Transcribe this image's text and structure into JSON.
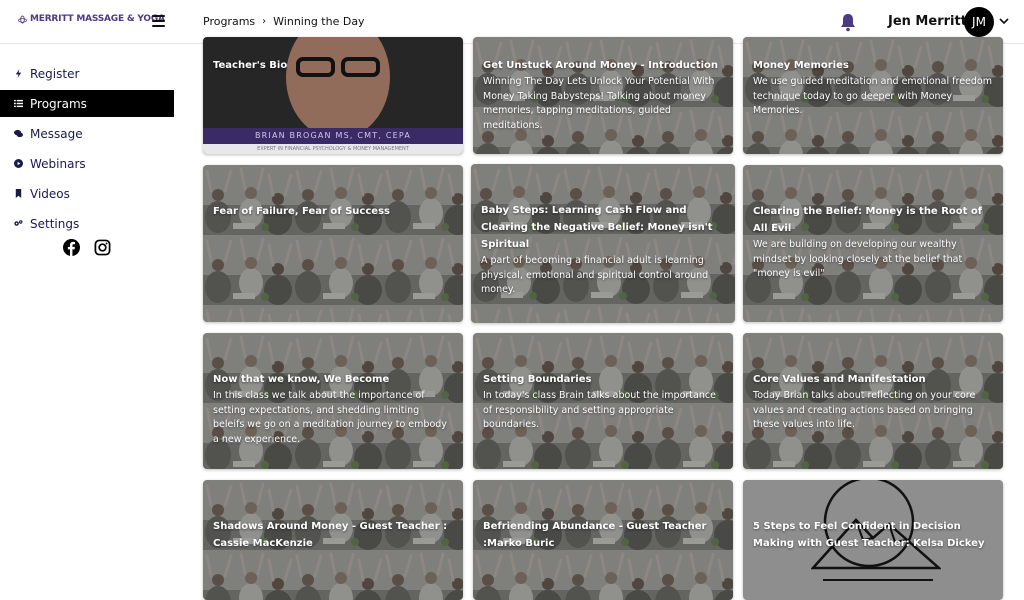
{
  "app": {
    "logo_text": "MERRITT MASSAGE & YOGA",
    "brand_color": "#4b3b86"
  },
  "breadcrumb": {
    "items": [
      "Programs",
      "Winning the Day"
    ]
  },
  "user": {
    "name": "Jen Merritt",
    "initials": "JM"
  },
  "sidebar": {
    "items": [
      {
        "label": "Register",
        "icon": "bolt-icon",
        "active": false
      },
      {
        "label": "Programs",
        "icon": "list-icon",
        "active": true
      },
      {
        "label": "Message",
        "icon": "chat-icon",
        "active": false
      },
      {
        "label": "Webinars",
        "icon": "play-circle-icon",
        "active": false
      },
      {
        "label": "Videos",
        "icon": "bookmark-icon",
        "active": false
      },
      {
        "label": "Settings",
        "icon": "gears-icon",
        "active": false
      }
    ],
    "social": [
      "facebook-icon",
      "instagram-icon"
    ]
  },
  "cards": [
    {
      "title": "Teacher's Bio",
      "desc": "",
      "image": "portrait",
      "band": "BRIAN BROGAN MS, CMT, CEPA",
      "band_sub": "EXPERT IN FINANCIAL PSYCHOLOGY & MONEY MANAGEMENT"
    },
    {
      "title": "Get Unstuck Around Money - Introduction",
      "desc": "Winning The Day Lets Unlock Your Potential With Money Taking Babysteps! Talking about money memories, tapping meditations, guided meditations.",
      "image": "crowd"
    },
    {
      "title": "Money Memories",
      "desc": "We use guided meditation and emotional freedom technique today to go deeper with Money Memories.",
      "image": "crowd"
    },
    {
      "title": "Fear of Failure, Fear of Success",
      "desc": "",
      "image": "crowd"
    },
    {
      "title": "Baby Steps: Learning Cash Flow and Clearing the Negative Belief: Money isn't Spiritual",
      "desc": "A part of becoming a financial adult is learning physical, emotional and spiritual control around money.",
      "image": "crowd"
    },
    {
      "title": "Clearing the Belief: Money is the Root of All Evil",
      "desc": "We are building on developing our wealthy mindset by looking closely at the belief that \"money is evil\"",
      "image": "crowd"
    },
    {
      "title": "Now that we know, We Become",
      "desc": "In this class we talk about the importance of setting expectations, and shedding limiting beleifs we go on a meditation journey to embody a new experience.",
      "image": "crowd"
    },
    {
      "title": "Setting Boundaries",
      "desc": "In today's class Brain talks about the importance of responsibility and setting appropriate boundaries.",
      "image": "crowd"
    },
    {
      "title": "Core Values and Manifestation",
      "desc": "Today Brian talks about reflecting on your core values and creating actions based on bringing these values into life.",
      "image": "crowd"
    },
    {
      "title": "Shadows Around Money - Guest Teacher : Cassie MacKenzie",
      "desc": "",
      "image": "crowd"
    },
    {
      "title": "Befriending Abundance - Guest Teacher :Marko Buric",
      "desc": "",
      "image": "crowd"
    },
    {
      "title": "5 Steps to Feel Confident in Decision Making with Guest Teacher: Kelsa Dickey",
      "desc": "",
      "image": "mountain"
    }
  ]
}
